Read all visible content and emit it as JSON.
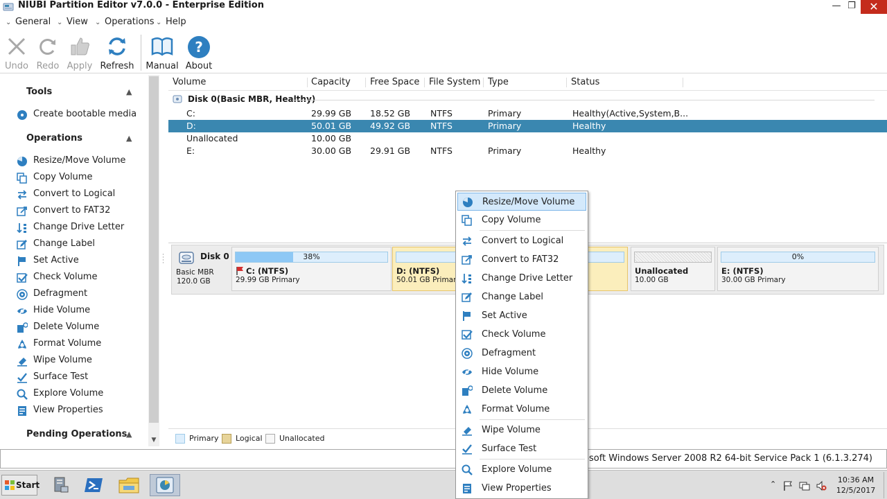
{
  "window": {
    "title": "NIUBI Partition Editor v7.0.0 - Enterprise Edition",
    "controls": {
      "minimize": "—",
      "restore": "❐",
      "close": "✕"
    }
  },
  "menu": [
    "General",
    "View",
    "Operations",
    "Help"
  ],
  "toolbar": {
    "undo": "Undo",
    "redo": "Redo",
    "apply": "Apply",
    "refresh": "Refresh",
    "manual": "Manual",
    "about": "About"
  },
  "sidebar": {
    "tools_title": "Tools",
    "tools": [
      "Create bootable media"
    ],
    "operations_title": "Operations",
    "operations": [
      "Resize/Move Volume",
      "Copy Volume",
      "Convert to Logical",
      "Convert to FAT32",
      "Change Drive Letter",
      "Change Label",
      "Set Active",
      "Check Volume",
      "Defragment",
      "Hide Volume",
      "Delete Volume",
      "Format Volume",
      "Wipe Volume",
      "Surface Test",
      "Explore Volume",
      "View Properties"
    ],
    "pending_title": "Pending Operations"
  },
  "volume_list": {
    "columns": [
      "Volume",
      "Capacity",
      "Free Space",
      "File System",
      "Type",
      "Status"
    ],
    "disk_label": "Disk 0(Basic MBR, Healthy)",
    "rows": [
      {
        "volume": "C:",
        "capacity": "29.99 GB",
        "free": "18.52 GB",
        "fs": "NTFS",
        "type": "Primary",
        "status": "Healthy(Active,System,B..."
      },
      {
        "volume": "D:",
        "capacity": "50.01 GB",
        "free": "49.92 GB",
        "fs": "NTFS",
        "type": "Primary",
        "status": "Healthy"
      },
      {
        "volume": "Unallocated",
        "capacity": "10.00 GB",
        "free": "",
        "fs": "",
        "type": "",
        "status": ""
      },
      {
        "volume": "E:",
        "capacity": "30.00 GB",
        "free": "29.91 GB",
        "fs": "NTFS",
        "type": "Primary",
        "status": "Healthy"
      }
    ],
    "selected_row": 1
  },
  "disk_map": {
    "disk_name": "Disk 0",
    "disk_type": "Basic MBR",
    "disk_size": "120.0 GB",
    "partitions": [
      {
        "name": "C: (NTFS)",
        "detail": "29.99 GB Primary",
        "usage_label": "38%",
        "usage": 0.38
      },
      {
        "name": "D: (NTFS)",
        "detail": "50.01 GB Primary",
        "usage_label": "",
        "usage": 0.0
      },
      {
        "name": "Unallocated",
        "detail": "10.00 GB",
        "usage_label": "",
        "usage": 0.0
      },
      {
        "name": "E: (NTFS)",
        "detail": "30.00 GB Primary",
        "usage_label": "0%",
        "usage": 0.0
      }
    ]
  },
  "legend": [
    "Primary",
    "Logical",
    "Unallocated"
  ],
  "status_bar": "n: Microsoft Windows Server 2008 R2  64-bit Service Pack 1 (6.1.3.274)",
  "context_menu": [
    "Resize/Move Volume",
    "Copy Volume",
    "Convert to Logical",
    "Convert to FAT32",
    "Change Drive Letter",
    "Change Label",
    "Set Active",
    "Check Volume",
    "Defragment",
    "Hide Volume",
    "Delete Volume",
    "Format Volume",
    "Wipe Volume",
    "Surface Test",
    "Explore Volume",
    "View Properties"
  ],
  "taskbar": {
    "start": "Start",
    "time": "10:36 AM",
    "date": "12/5/2017"
  },
  "colors": {
    "accent": "#3a87b0",
    "selected_partition": "#fbeebc",
    "usage_fill": "#8ec8f5",
    "icon_blue": "#2e7fc0"
  }
}
